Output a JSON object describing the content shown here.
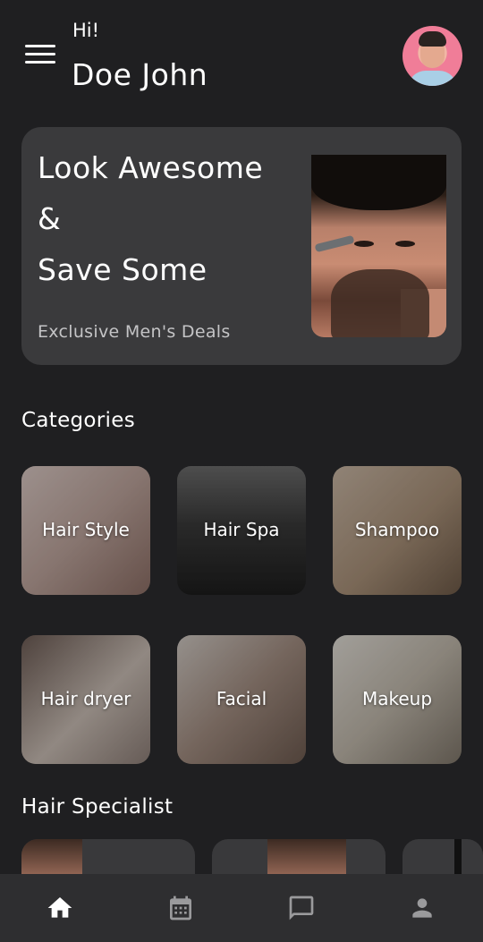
{
  "header": {
    "greeting": "Hi!",
    "username": "Doe John"
  },
  "promo": {
    "line1": "Look Awesome",
    "line2": "&",
    "line3": "Save Some",
    "subtitle": "Exclusive Men's Deals"
  },
  "categories": {
    "title": "Categories",
    "items": [
      {
        "label": "Hair Style"
      },
      {
        "label": "Hair Spa"
      },
      {
        "label": "Shampoo"
      },
      {
        "label": "Hair dryer"
      },
      {
        "label": "Facial"
      },
      {
        "label": "Makeup"
      }
    ]
  },
  "specialists": {
    "title": "Hair Specialist"
  },
  "bottom_nav": {
    "items": [
      {
        "icon": "home-icon",
        "active": true
      },
      {
        "icon": "calendar-icon",
        "active": false
      },
      {
        "icon": "chat-icon",
        "active": false
      },
      {
        "icon": "person-icon",
        "active": false
      }
    ]
  },
  "colors": {
    "background": "#1f1f21",
    "card": "#3a3a3c",
    "nav_background": "#2e2e30",
    "active_icon": "#ffffff",
    "inactive_icon": "#9a9a9c"
  }
}
